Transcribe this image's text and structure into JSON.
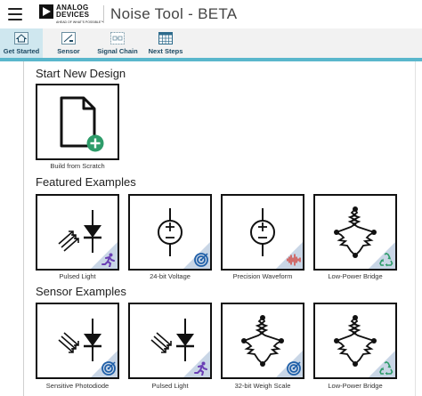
{
  "header": {
    "logo_line1": "ANALOG",
    "logo_line2": "DEVICES",
    "logo_tagline": "AHEAD OF WHAT'S POSSIBLE™",
    "app_title": "Noise Tool - BETA"
  },
  "toolbar": {
    "tabs": [
      {
        "label": "Get Started",
        "icon": "home-icon",
        "active": true
      },
      {
        "label": "Sensor",
        "icon": "sensor-icon",
        "active": false
      },
      {
        "label": "Signal Chain",
        "icon": "signal-chain-icon",
        "active": false
      },
      {
        "label": "Next Steps",
        "icon": "calendar-grid-icon",
        "active": false
      }
    ]
  },
  "sections": {
    "start_new": {
      "title": "Start New Design",
      "cards": [
        {
          "caption": "Build from Scratch",
          "icon": "new-document-icon"
        }
      ]
    },
    "featured": {
      "title": "Featured Examples",
      "cards": [
        {
          "caption": "Pulsed Light",
          "icon": "led-icon",
          "badge": "running-person-icon"
        },
        {
          "caption": "24-bit Voltage",
          "icon": "voltage-source-icon",
          "badge": "target-icon"
        },
        {
          "caption": "Precision Waveform",
          "icon": "voltage-source-icon",
          "badge": "waveform-icon"
        },
        {
          "caption": "Low-Power Bridge",
          "icon": "bridge-icon",
          "badge": "recycle-icon"
        }
      ]
    },
    "sensor": {
      "title": "Sensor Examples",
      "cards": [
        {
          "caption": "Sensitive Photodiode",
          "icon": "photodiode-icon",
          "badge": "target-icon"
        },
        {
          "caption": "Pulsed Light",
          "icon": "photodiode-icon",
          "badge": "running-person-icon"
        },
        {
          "caption": "32-bit Weigh Scale",
          "icon": "bridge-icon",
          "badge": "target-icon"
        },
        {
          "caption": "Low-Power Bridge",
          "icon": "bridge-icon",
          "badge": "recycle-icon"
        }
      ]
    }
  },
  "colors": {
    "active_tab": "#cfe7ef",
    "accent_strip": "#5ab7cc",
    "tab_text": "#1e4a63",
    "badge_triangle": "#c9d6e6",
    "plus_badge": "#2e9c6a",
    "runner_purple": "#6a3fb5",
    "target_blue": "#1f5fa8",
    "waveform_red": "#d3332a",
    "recycle_green": "#2e9c6a"
  }
}
